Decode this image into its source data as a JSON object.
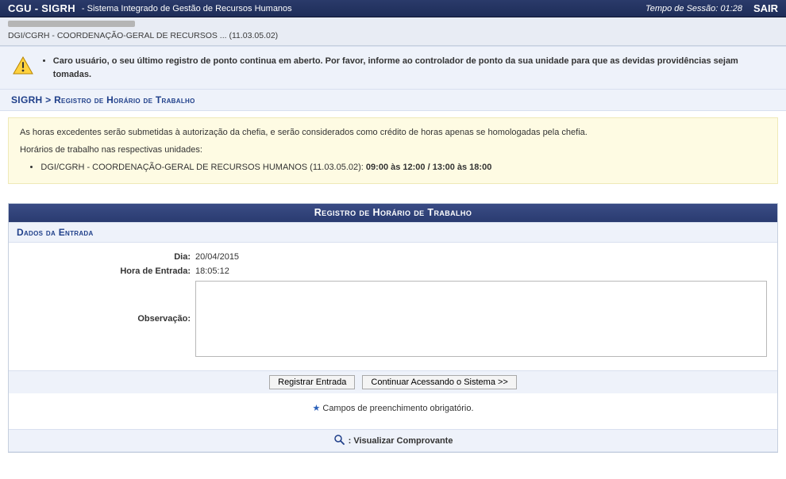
{
  "topbar": {
    "brand": "CGU - SIGRH",
    "subtitle": "- Sistema Integrado de Gestão de Recursos Humanos",
    "session_label": "Tempo de Sessão:",
    "session_time": "01:28",
    "logout": "SAIR"
  },
  "breadcrumb": {
    "path": "DGI/CGRH - COORDENAÇÃO-GERAL DE RECURSOS ... (11.03.05.02)"
  },
  "alert": {
    "message": "Caro usuário, o seu último registro de ponto continua em aberto. Por favor, informe ao controlador de ponto da sua unidade para que as devidas providências sejam tomadas."
  },
  "page_title": {
    "root": "SIGRH",
    "sep": " > ",
    "page": "Registro de Horário de Trabalho"
  },
  "info": {
    "line1": "As horas excedentes serão submetidas à autorização da chefia, e serão considerados como crédito de horas apenas se homologadas pela chefia.",
    "line2": "Horários de trabalho nas respectivas unidades:",
    "unit_prefix": "DGI/CGRH - COORDENAÇÃO-GERAL DE RECURSOS HUMANOS (11.03.05.02): ",
    "unit_hours": "09:00 às 12:00 / 13:00 às 18:00"
  },
  "panel": {
    "header": "Registro de Horário de Trabalho",
    "section": "Dados da Entrada",
    "fields": {
      "dia_label": "Dia:",
      "dia_value": "20/04/2015",
      "hora_label": "Hora de Entrada:",
      "hora_value": "18:05:12",
      "obs_label": "Observação:",
      "obs_value": ""
    },
    "buttons": {
      "registrar": "Registrar Entrada",
      "continuar": "Continuar Acessando o Sistema >>"
    },
    "footnote": "Campos de preenchimento obrigatório.",
    "legend": ": Visualizar Comprovante"
  }
}
